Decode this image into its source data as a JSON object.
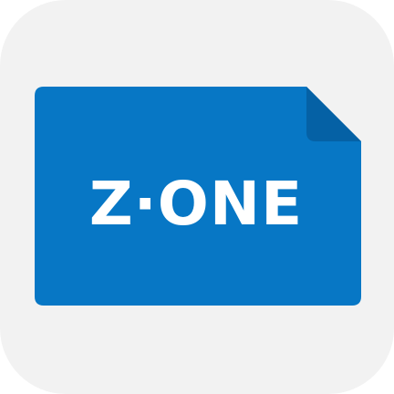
{
  "icon": {
    "label": "Z·ONE",
    "symbol": "file-card-icon",
    "colors": {
      "background": "#f2f2f2",
      "card": "#0777c5",
      "fold": "#0561a5",
      "text": "#ffffff"
    }
  }
}
